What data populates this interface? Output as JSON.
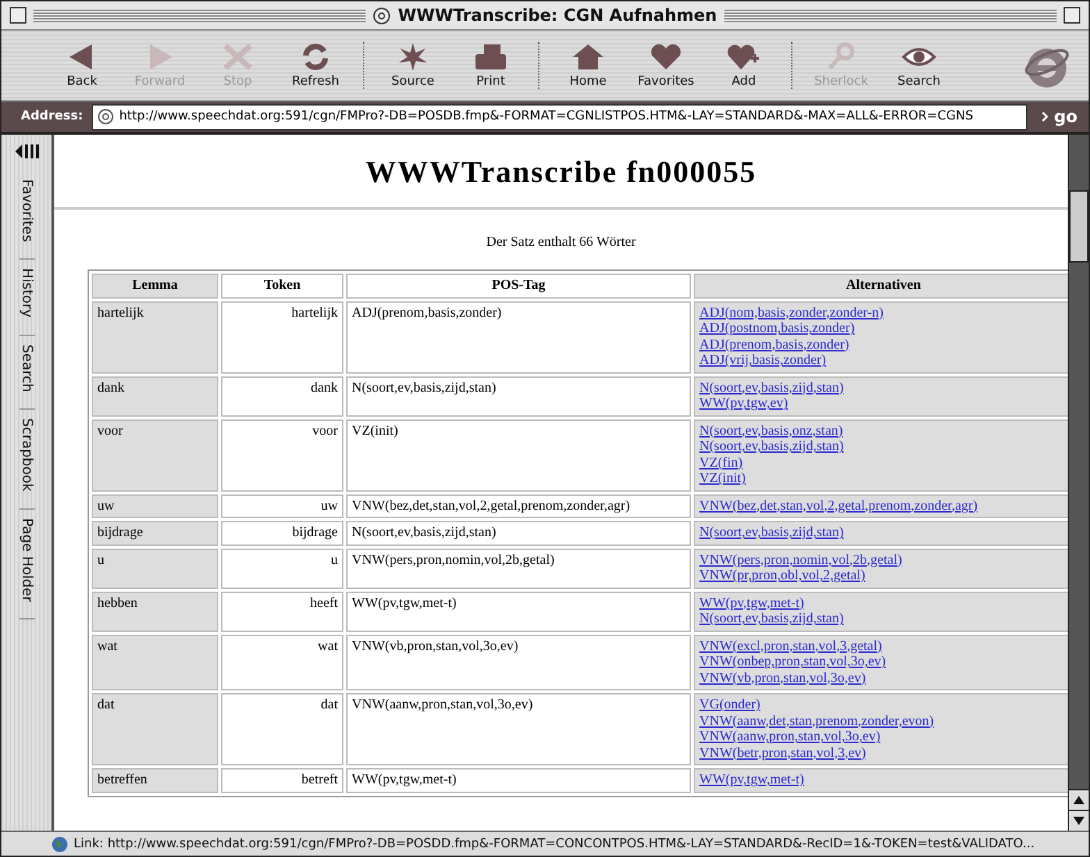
{
  "window": {
    "title": "WWWTranscribe: CGN Aufnahmen"
  },
  "toolbar": [
    {
      "kind": "button",
      "label": "Back",
      "disabled": false
    },
    {
      "kind": "button",
      "label": "Forward",
      "disabled": true
    },
    {
      "kind": "button",
      "label": "Stop",
      "disabled": true
    },
    {
      "kind": "button",
      "label": "Refresh",
      "disabled": false
    },
    {
      "kind": "separator"
    },
    {
      "kind": "button",
      "label": "Source",
      "disabled": false
    },
    {
      "kind": "button",
      "label": "Print",
      "disabled": false
    },
    {
      "kind": "separator"
    },
    {
      "kind": "button",
      "label": "Home",
      "disabled": false
    },
    {
      "kind": "button",
      "label": "Favorites",
      "disabled": false
    },
    {
      "kind": "button",
      "label": "Add",
      "disabled": false
    },
    {
      "kind": "separator"
    },
    {
      "kind": "button",
      "label": "Sherlock",
      "disabled": true
    },
    {
      "kind": "button",
      "label": "Search",
      "disabled": false
    }
  ],
  "address": {
    "label": "Address:",
    "value": "http://www.speechdat.org:591/cgn/FMPro?-DB=POSDB.fmp&-FORMAT=CGNLISTPOS.HTM&-LAY=STANDARD&-MAX=ALL&-ERROR=CGNS",
    "go": "go"
  },
  "sidebar_tabs": [
    "Favorites",
    "History",
    "Search",
    "Scrapbook",
    "Page Holder"
  ],
  "page": {
    "heading": "WWWTranscribe fn000055",
    "summary": "Der Satz enthalt 66 Wörter"
  },
  "table": {
    "columns": [
      "Lemma",
      "Token",
      "POS-Tag",
      "Alternativen"
    ],
    "rows": [
      {
        "lemma": "hartelijk",
        "token": "hartelijk",
        "pos": "ADJ(prenom,basis,zonder)",
        "alternatives": [
          "ADJ(nom,basis,zonder,zonder-n)",
          "ADJ(postnom,basis,zonder)",
          "ADJ(prenom,basis,zonder)",
          "ADJ(vrij,basis,zonder)"
        ]
      },
      {
        "lemma": "dank",
        "token": "dank",
        "pos": "N(soort,ev,basis,zijd,stan)",
        "alternatives": [
          "N(soort,ev,basis,zijd,stan)",
          "WW(pv,tgw,ev)"
        ]
      },
      {
        "lemma": "voor",
        "token": "voor",
        "pos": "VZ(init)",
        "alternatives": [
          "N(soort,ev,basis,onz,stan)",
          "N(soort,ev,basis,zijd,stan)",
          "VZ(fin)",
          "VZ(init)"
        ]
      },
      {
        "lemma": "uw",
        "token": "uw",
        "pos": "VNW(bez,det,stan,vol,2,getal,prenom,zonder,agr)",
        "alternatives": [
          "VNW(bez,det,stan,vol,2,getal,prenom,zonder,agr)"
        ]
      },
      {
        "lemma": "bijdrage",
        "token": "bijdrage",
        "pos": "N(soort,ev,basis,zijd,stan)",
        "alternatives": [
          "N(soort,ev,basis,zijd,stan)"
        ]
      },
      {
        "lemma": "u",
        "token": "u",
        "pos": "VNW(pers,pron,nomin,vol,2b,getal)",
        "alternatives": [
          "VNW(pers,pron,nomin,vol,2b,getal)",
          "VNW(pr,pron,obl,vol,2,getal)"
        ]
      },
      {
        "lemma": "hebben",
        "token": "heeft",
        "pos": "WW(pv,tgw,met-t)",
        "alternatives": [
          "WW(pv,tgw,met-t)",
          "N(soort,ev,basis,zijd,stan)"
        ]
      },
      {
        "lemma": "wat",
        "token": "wat",
        "pos": "VNW(vb,pron,stan,vol,3o,ev)",
        "alternatives": [
          "VNW(excl,pron,stan,vol,3,getal)",
          "VNW(onbep,pron,stan,vol,3o,ev)",
          "VNW(vb,pron,stan,vol,3o,ev)"
        ]
      },
      {
        "lemma": "dat",
        "token": "dat",
        "pos": "VNW(aanw,pron,stan,vol,3o,ev)",
        "alternatives": [
          "VG(onder)",
          "VNW(aanw,det,stan,prenom,zonder,evon)",
          "VNW(aanw,pron,stan,vol,3o,ev)",
          "VNW(betr,pron,stan,vol,3,ev)"
        ]
      },
      {
        "lemma": "betreffen",
        "token": "betreft",
        "pos": "WW(pv,tgw,met-t)",
        "alternatives": [
          "WW(pv,tgw,met-t)"
        ]
      }
    ]
  },
  "status_bar": "Link: http://www.speechdat.org:591/cgn/FMPro?-DB=POSDD.fmp&-FORMAT=CONCONTPOS.HTM&-LAY=STANDARD&-RecID=1&-TOKEN=test&VALIDATO..."
}
